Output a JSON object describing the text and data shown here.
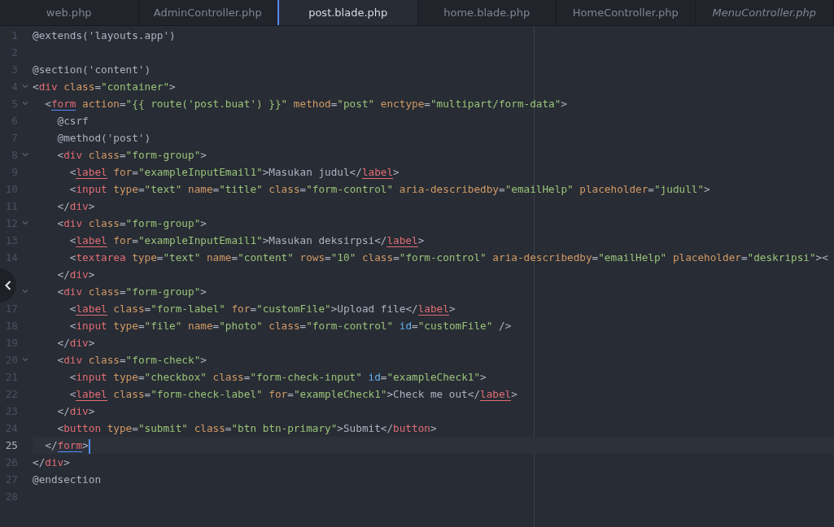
{
  "tabs": [
    {
      "label": "web.php",
      "selected": false,
      "pending": false
    },
    {
      "label": "AdminController.php",
      "selected": false,
      "pending": false
    },
    {
      "label": "post.blade.php",
      "selected": true,
      "pending": false
    },
    {
      "label": "home.blade.php",
      "selected": false,
      "pending": false
    },
    {
      "label": "HomeController.php",
      "selected": false,
      "pending": false
    },
    {
      "label": "MenuController.php",
      "selected": false,
      "pending": true
    }
  ],
  "editor": {
    "lines": [
      {
        "number": "1",
        "foldable": false,
        "selected": false,
        "tokens": [
          {
            "kind": "plain",
            "text": "@extends('layouts.app')"
          }
        ]
      },
      {
        "number": "2",
        "foldable": false,
        "selected": false
      },
      {
        "number": "3",
        "foldable": false,
        "selected": false,
        "tokens": [
          {
            "kind": "plain",
            "text": "@section('content')"
          }
        ]
      },
      {
        "number": "4",
        "foldable": true,
        "selected": false,
        "tokens": [
          {
            "kind": "plain",
            "text": "<"
          },
          {
            "kind": "tag",
            "text": "div"
          },
          {
            "kind": "attr",
            "text": " class"
          },
          {
            "kind": "plain",
            "text": "="
          },
          {
            "kind": "string",
            "text": "\"container\""
          },
          {
            "kind": "plain",
            "text": ">"
          }
        ]
      },
      {
        "number": "5",
        "foldable": true,
        "selected": false,
        "tokens": [
          {
            "kind": "plain",
            "text": "  <"
          },
          {
            "kind": "tag-match",
            "text": "form"
          },
          {
            "kind": "attr",
            "text": " action"
          },
          {
            "kind": "plain",
            "text": "="
          },
          {
            "kind": "string",
            "text": "\"{{ route('post.buat') }}\""
          },
          {
            "kind": "attr",
            "text": " method"
          },
          {
            "kind": "plain",
            "text": "="
          },
          {
            "kind": "string",
            "text": "\"post\""
          },
          {
            "kind": "attr",
            "text": " enctype"
          },
          {
            "kind": "plain",
            "text": "="
          },
          {
            "kind": "string",
            "text": "\"multipart/form-data\""
          },
          {
            "kind": "plain",
            "text": ">"
          }
        ]
      },
      {
        "number": "6",
        "foldable": false,
        "selected": false,
        "tokens": [
          {
            "kind": "plain",
            "text": "    @csrf"
          }
        ]
      },
      {
        "number": "7",
        "foldable": false,
        "selected": false,
        "tokens": [
          {
            "kind": "plain",
            "text": "    @method('post')"
          }
        ]
      },
      {
        "number": "8",
        "foldable": true,
        "selected": false,
        "tokens": [
          {
            "kind": "plain",
            "text": "    <"
          },
          {
            "kind": "tag",
            "text": "div"
          },
          {
            "kind": "attr",
            "text": " class"
          },
          {
            "kind": "plain",
            "text": "="
          },
          {
            "kind": "string",
            "text": "\"form-group\""
          },
          {
            "kind": "plain",
            "text": ">"
          }
        ]
      },
      {
        "number": "9",
        "foldable": false,
        "selected": false,
        "tokens": [
          {
            "kind": "plain",
            "text": "      <"
          },
          {
            "kind": "tag-flag",
            "text": "label"
          },
          {
            "kind": "attr",
            "text": " for"
          },
          {
            "kind": "plain",
            "text": "="
          },
          {
            "kind": "string",
            "text": "\"exampleInputEmail1\""
          },
          {
            "kind": "plain",
            "text": ">Masukan judul</"
          },
          {
            "kind": "tag-flag",
            "text": "label"
          },
          {
            "kind": "plain",
            "text": ">"
          }
        ]
      },
      {
        "number": "10",
        "foldable": false,
        "selected": false,
        "tokens": [
          {
            "kind": "plain",
            "text": "      <"
          },
          {
            "kind": "tag",
            "text": "input"
          },
          {
            "kind": "attr",
            "text": " type"
          },
          {
            "kind": "plain",
            "text": "="
          },
          {
            "kind": "string",
            "text": "\"text\""
          },
          {
            "kind": "attr",
            "text": " name"
          },
          {
            "kind": "plain",
            "text": "="
          },
          {
            "kind": "string",
            "text": "\"title\""
          },
          {
            "kind": "attr",
            "text": " class"
          },
          {
            "kind": "plain",
            "text": "="
          },
          {
            "kind": "string",
            "text": "\"form-control\""
          },
          {
            "kind": "attr",
            "text": " aria-describedby"
          },
          {
            "kind": "plain",
            "text": "="
          },
          {
            "kind": "string",
            "text": "\"emailHelp\""
          },
          {
            "kind": "attr",
            "text": " placeholder"
          },
          {
            "kind": "plain",
            "text": "="
          },
          {
            "kind": "string",
            "text": "\"judull\""
          },
          {
            "kind": "plain",
            "text": ">"
          }
        ]
      },
      {
        "number": "11",
        "foldable": false,
        "selected": false,
        "tokens": [
          {
            "kind": "plain",
            "text": "    </"
          },
          {
            "kind": "tag",
            "text": "div"
          },
          {
            "kind": "plain",
            "text": ">"
          }
        ]
      },
      {
        "number": "12",
        "foldable": true,
        "selected": false,
        "tokens": [
          {
            "kind": "plain",
            "text": "    <"
          },
          {
            "kind": "tag",
            "text": "div"
          },
          {
            "kind": "attr",
            "text": " class"
          },
          {
            "kind": "plain",
            "text": "="
          },
          {
            "kind": "string",
            "text": "\"form-group\""
          },
          {
            "kind": "plain",
            "text": ">"
          }
        ]
      },
      {
        "number": "13",
        "foldable": false,
        "selected": false,
        "tokens": [
          {
            "kind": "plain",
            "text": "      <"
          },
          {
            "kind": "tag-flag",
            "text": "label"
          },
          {
            "kind": "attr",
            "text": " for"
          },
          {
            "kind": "plain",
            "text": "="
          },
          {
            "kind": "string",
            "text": "\"exampleInputEmail1\""
          },
          {
            "kind": "plain",
            "text": ">Masukan deksirpsi</"
          },
          {
            "kind": "tag-flag",
            "text": "label"
          },
          {
            "kind": "plain",
            "text": ">"
          }
        ]
      },
      {
        "number": "14",
        "foldable": false,
        "selected": false,
        "tokens": [
          {
            "kind": "plain",
            "text": "      <"
          },
          {
            "kind": "tag",
            "text": "textarea"
          },
          {
            "kind": "attr",
            "text": " type"
          },
          {
            "kind": "plain",
            "text": "="
          },
          {
            "kind": "string",
            "text": "\"text\""
          },
          {
            "kind": "attr",
            "text": " name"
          },
          {
            "kind": "plain",
            "text": "="
          },
          {
            "kind": "string",
            "text": "\"content\""
          },
          {
            "kind": "attr",
            "text": " rows"
          },
          {
            "kind": "plain",
            "text": "="
          },
          {
            "kind": "string",
            "text": "\"10\""
          },
          {
            "kind": "attr",
            "text": " class"
          },
          {
            "kind": "plain",
            "text": "="
          },
          {
            "kind": "string",
            "text": "\"form-control\""
          },
          {
            "kind": "attr",
            "text": " aria-describedby"
          },
          {
            "kind": "plain",
            "text": "="
          },
          {
            "kind": "string",
            "text": "\"emailHelp\""
          },
          {
            "kind": "attr",
            "text": " placeholder"
          },
          {
            "kind": "plain",
            "text": "="
          },
          {
            "kind": "string",
            "text": "\"deskripsi\""
          },
          {
            "kind": "plain",
            "text": "><"
          }
        ]
      },
      {
        "foldable": false,
        "selected": false,
        "tokens": [
          {
            "kind": "plain",
            "text": "    </"
          },
          {
            "kind": "tag",
            "text": "div"
          },
          {
            "kind": "plain",
            "text": ">"
          }
        ]
      },
      {
        "foldable": true,
        "selected": false,
        "tokens": [
          {
            "kind": "plain",
            "text": "    <"
          },
          {
            "kind": "tag",
            "text": "div"
          },
          {
            "kind": "attr",
            "text": " class"
          },
          {
            "kind": "plain",
            "text": "="
          },
          {
            "kind": "string",
            "text": "\"form-group\""
          },
          {
            "kind": "plain",
            "text": ">"
          }
        ]
      },
      {
        "number": "17",
        "foldable": false,
        "selected": false,
        "tokens": [
          {
            "kind": "plain",
            "text": "      <"
          },
          {
            "kind": "tag-flag",
            "text": "label"
          },
          {
            "kind": "attr",
            "text": " class"
          },
          {
            "kind": "plain",
            "text": "="
          },
          {
            "kind": "string",
            "text": "\"form-label\""
          },
          {
            "kind": "attr",
            "text": " for"
          },
          {
            "kind": "plain",
            "text": "="
          },
          {
            "kind": "string",
            "text": "\"customFile\""
          },
          {
            "kind": "plain",
            "text": ">Upload file</"
          },
          {
            "kind": "tag-flag",
            "text": "label"
          },
          {
            "kind": "plain",
            "text": ">"
          }
        ]
      },
      {
        "number": "18",
        "foldable": false,
        "selected": false,
        "tokens": [
          {
            "kind": "plain",
            "text": "      <"
          },
          {
            "kind": "tag",
            "text": "input"
          },
          {
            "kind": "attr",
            "text": " type"
          },
          {
            "kind": "plain",
            "text": "="
          },
          {
            "kind": "string",
            "text": "\"file\""
          },
          {
            "kind": "attr",
            "text": " name"
          },
          {
            "kind": "plain",
            "text": "="
          },
          {
            "kind": "string",
            "text": "\"photo\""
          },
          {
            "kind": "attr",
            "text": " class"
          },
          {
            "kind": "plain",
            "text": "="
          },
          {
            "kind": "string",
            "text": "\"form-control\""
          },
          {
            "kind": "id",
            "text": " id"
          },
          {
            "kind": "plain",
            "text": "="
          },
          {
            "kind": "string",
            "text": "\"customFile\""
          },
          {
            "kind": "plain",
            "text": " />"
          }
        ]
      },
      {
        "number": "19",
        "foldable": false,
        "selected": false,
        "tokens": [
          {
            "kind": "plain",
            "text": "    </"
          },
          {
            "kind": "tag",
            "text": "div"
          },
          {
            "kind": "plain",
            "text": ">"
          }
        ]
      },
      {
        "number": "20",
        "foldable": true,
        "selected": false,
        "tokens": [
          {
            "kind": "plain",
            "text": "    <"
          },
          {
            "kind": "tag",
            "text": "div"
          },
          {
            "kind": "attr",
            "text": " class"
          },
          {
            "kind": "plain",
            "text": "="
          },
          {
            "kind": "string",
            "text": "\"form-check\""
          },
          {
            "kind": "plain",
            "text": ">"
          }
        ]
      },
      {
        "number": "21",
        "foldable": false,
        "selected": false,
        "tokens": [
          {
            "kind": "plain",
            "text": "      <"
          },
          {
            "kind": "tag",
            "text": "input"
          },
          {
            "kind": "attr",
            "text": " type"
          },
          {
            "kind": "plain",
            "text": "="
          },
          {
            "kind": "string",
            "text": "\"checkbox\""
          },
          {
            "kind": "attr",
            "text": " class"
          },
          {
            "kind": "plain",
            "text": "="
          },
          {
            "kind": "string",
            "text": "\"form-check-input\""
          },
          {
            "kind": "id",
            "text": " id"
          },
          {
            "kind": "plain",
            "text": "="
          },
          {
            "kind": "string",
            "text": "\"exampleCheck1\""
          },
          {
            "kind": "plain",
            "text": ">"
          }
        ]
      },
      {
        "number": "22",
        "foldable": false,
        "selected": false,
        "tokens": [
          {
            "kind": "plain",
            "text": "      <"
          },
          {
            "kind": "tag-flag",
            "text": "label"
          },
          {
            "kind": "attr",
            "text": " class"
          },
          {
            "kind": "plain",
            "text": "="
          },
          {
            "kind": "string",
            "text": "\"form-check-label\""
          },
          {
            "kind": "attr",
            "text": " for"
          },
          {
            "kind": "plain",
            "text": "="
          },
          {
            "kind": "string",
            "text": "\"exampleCheck1\""
          },
          {
            "kind": "plain",
            "text": ">Check me out</"
          },
          {
            "kind": "tag-flag",
            "text": "label"
          },
          {
            "kind": "plain",
            "text": ">"
          }
        ]
      },
      {
        "number": "23",
        "foldable": false,
        "selected": false,
        "tokens": [
          {
            "kind": "plain",
            "text": "    </"
          },
          {
            "kind": "tag",
            "text": "div"
          },
          {
            "kind": "plain",
            "text": ">"
          }
        ]
      },
      {
        "number": "24",
        "foldable": false,
        "selected": false,
        "tokens": [
          {
            "kind": "plain",
            "text": "    <"
          },
          {
            "kind": "tag",
            "text": "button"
          },
          {
            "kind": "attr",
            "text": " type"
          },
          {
            "kind": "plain",
            "text": "="
          },
          {
            "kind": "string",
            "text": "\"submit\""
          },
          {
            "kind": "attr",
            "text": " class"
          },
          {
            "kind": "plain",
            "text": "="
          },
          {
            "kind": "string",
            "text": "\"btn btn-primary\""
          },
          {
            "kind": "plain",
            "text": ">Submit</"
          },
          {
            "kind": "tag",
            "text": "button"
          },
          {
            "kind": "plain",
            "text": ">"
          }
        ]
      },
      {
        "number": "25",
        "foldable": false,
        "selected": true,
        "tokens": [
          {
            "kind": "plain",
            "text": "  </"
          },
          {
            "kind": "tag-match",
            "text": "form"
          },
          {
            "kind": "plain",
            "text": ">"
          }
        ]
      },
      {
        "number": "26",
        "foldable": false,
        "selected": false,
        "tokens": [
          {
            "kind": "plain",
            "text": "</"
          },
          {
            "kind": "tag",
            "text": "div"
          },
          {
            "kind": "plain",
            "text": ">"
          }
        ]
      },
      {
        "number": "27",
        "foldable": false,
        "selected": false,
        "tokens": [
          {
            "kind": "plain",
            "text": "@endsection"
          }
        ]
      },
      {
        "number": "28",
        "foldable": false,
        "selected": false
      }
    ]
  }
}
